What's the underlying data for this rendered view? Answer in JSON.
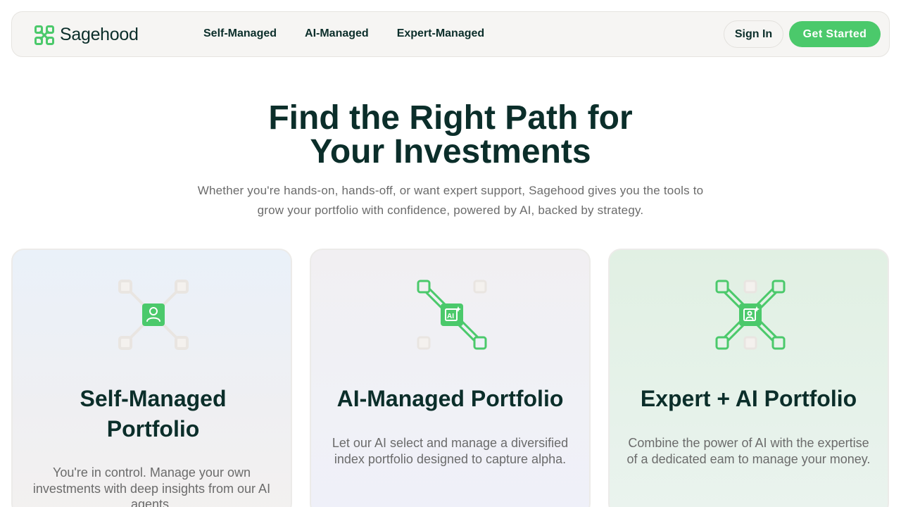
{
  "brand": {
    "name": "Sagehood",
    "accent": "#4bc96b",
    "dark": "#0b2e2a"
  },
  "nav": {
    "links": [
      "Self-Managed",
      "AI-Managed",
      "Expert-Managed"
    ],
    "sign_in": "Sign In",
    "get_started": "Get Started"
  },
  "hero": {
    "title_line1": "Find the Right Path for",
    "title_line2": "Your Investments",
    "subtitle": "Whether you're hands-on, hands-off, or want expert support, Sagehood gives you the tools to grow your portfolio with confidence, powered by AI, backed by strategy."
  },
  "cards": [
    {
      "icon": "person-icon",
      "title": "Self-Managed Portfolio",
      "description": "You're in control. Manage your own investments with deep insights from our AI agents."
    },
    {
      "icon": "ai-chip-icon",
      "title": "AI-Managed Portfolio",
      "description": "Let our AI select and manage a diversified index portfolio designed to capture alpha."
    },
    {
      "icon": "expert-ai-icon",
      "title": "Expert + AI Portfolio",
      "description": "Combine the power of AI with the expertise of a dedicated eam to manage your money."
    }
  ]
}
